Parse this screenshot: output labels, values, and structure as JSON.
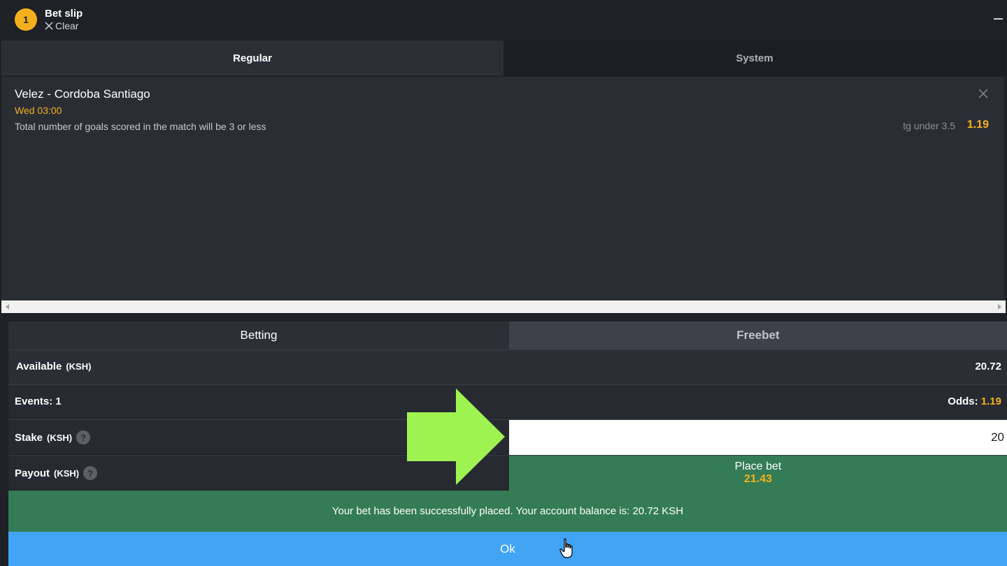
{
  "header": {
    "badge_count": "1",
    "title": "Bet slip",
    "clear_label": "Clear"
  },
  "slip_tabs": {
    "regular": "Regular",
    "system": "System"
  },
  "selection": {
    "match": "Velez - Cordoba Santiago",
    "time": "Wed 03:00",
    "description": "Total number of goals scored in the match will be 3 or less",
    "market": "tg under 3.5",
    "odds": "1.19"
  },
  "mode_tabs": {
    "betting": "Betting",
    "freebet": "Freebet"
  },
  "summary": {
    "available_label": "Available",
    "available_currency": "(KSH)",
    "available_value": "20.72",
    "events_label": "Events: 1",
    "odds_label": "Odds:",
    "odds_value": "1.19",
    "stake_label": "Stake",
    "stake_currency": "(KSH)",
    "stake_value": "20",
    "payout_label": "Payout",
    "payout_currency": "(KSH)",
    "help_glyph": "?"
  },
  "place_bet": {
    "label": "Place bet",
    "payout": "21.43"
  },
  "confirmation": {
    "message": "Your bet has been successfully placed. Your account balance is: 20.72 KSH",
    "ok_label": "Ok"
  },
  "colors": {
    "accent_yellow": "#f5b11c",
    "success_green": "#347c55",
    "ok_blue": "#42a4f5",
    "arrow_green": "#9ef351"
  }
}
